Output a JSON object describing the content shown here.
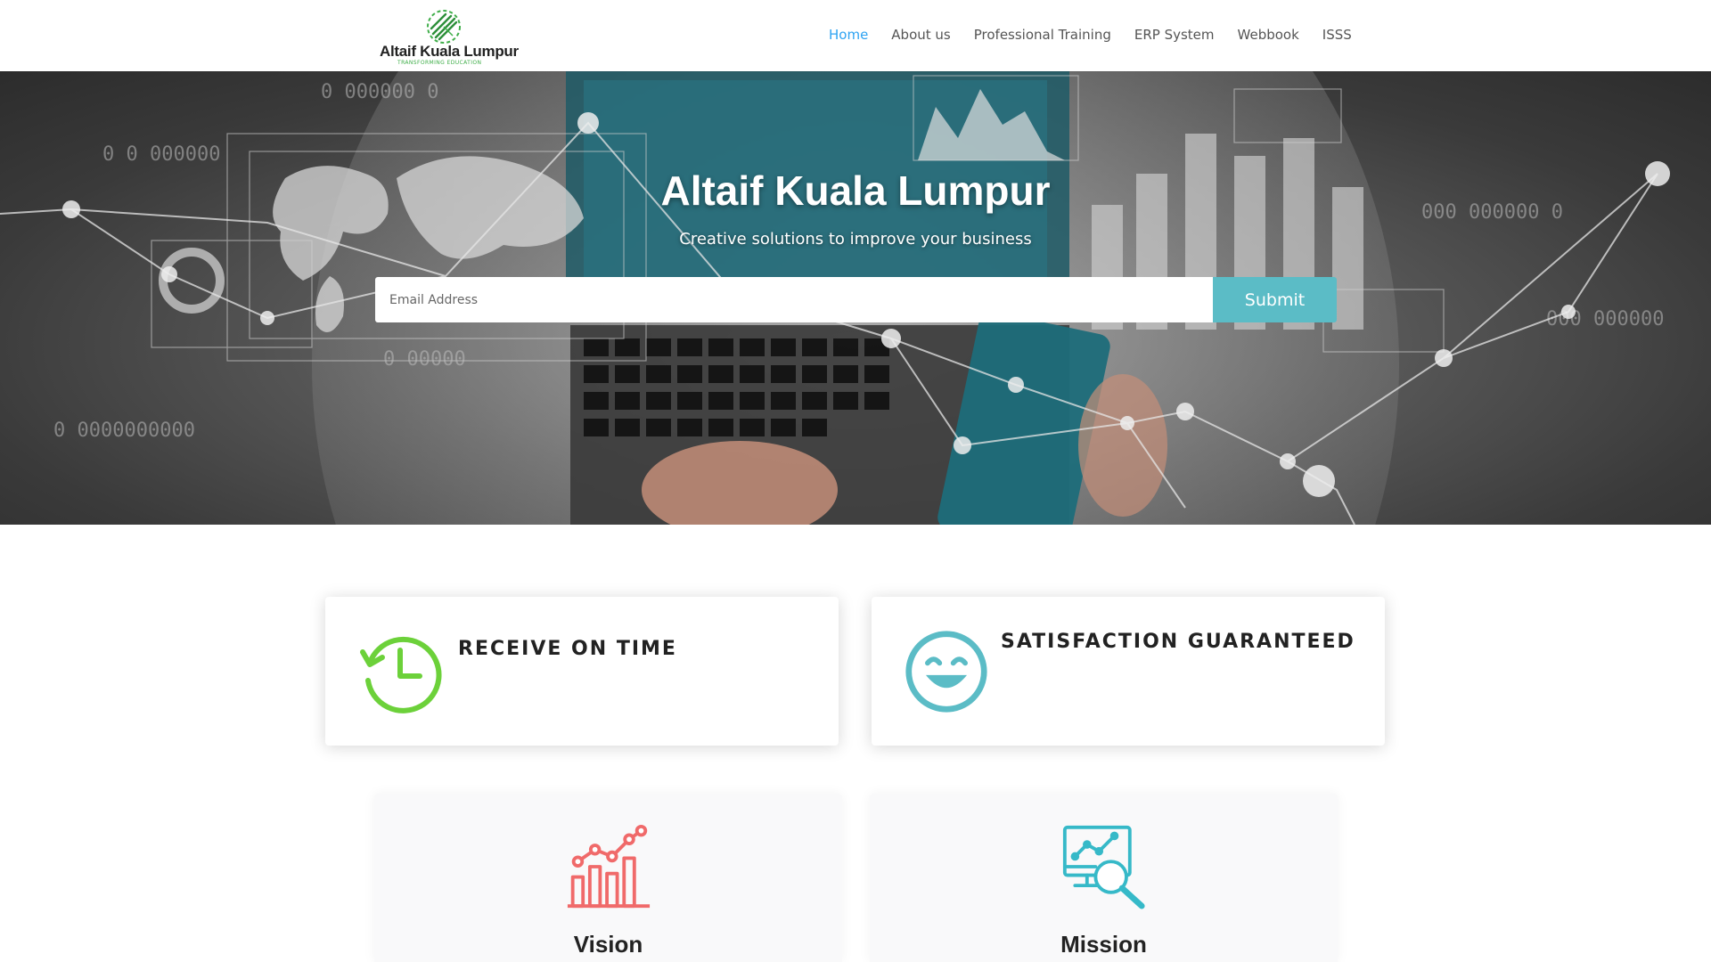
{
  "brand": {
    "name": "Altaif Kuala Lumpur",
    "tagline": "TRANSFORMING EDUCATION",
    "logo_color": "#3fae49"
  },
  "nav": {
    "items": [
      {
        "label": "Home",
        "active": true
      },
      {
        "label": "About us",
        "active": false
      },
      {
        "label": "Professional Training",
        "active": false
      },
      {
        "label": "ERP System",
        "active": false
      },
      {
        "label": "Webbook",
        "active": false
      },
      {
        "label": "ISSS",
        "active": false
      }
    ],
    "active_color": "#2ea3f2"
  },
  "hero": {
    "title": "Altaif Kuala Lumpur",
    "subtitle": "Creative solutions to improve your business",
    "email_placeholder": "Email Address",
    "submit_label": "Submit",
    "button_color": "#5bbcc6"
  },
  "features": [
    {
      "title": "RECEIVE ON TIME",
      "icon": "clock-history-icon",
      "icon_color": "#6cd13a"
    },
    {
      "title": "SATISFACTION GUARANTEED",
      "icon": "smiley-face-icon",
      "icon_color": "#5bbcc6"
    }
  ],
  "pillars": [
    {
      "title": "Vision",
      "icon": "growth-chart-icon",
      "icon_color": "#f06a6a"
    },
    {
      "title": "Mission",
      "icon": "monitor-search-icon",
      "icon_color": "#36b9c8"
    }
  ]
}
